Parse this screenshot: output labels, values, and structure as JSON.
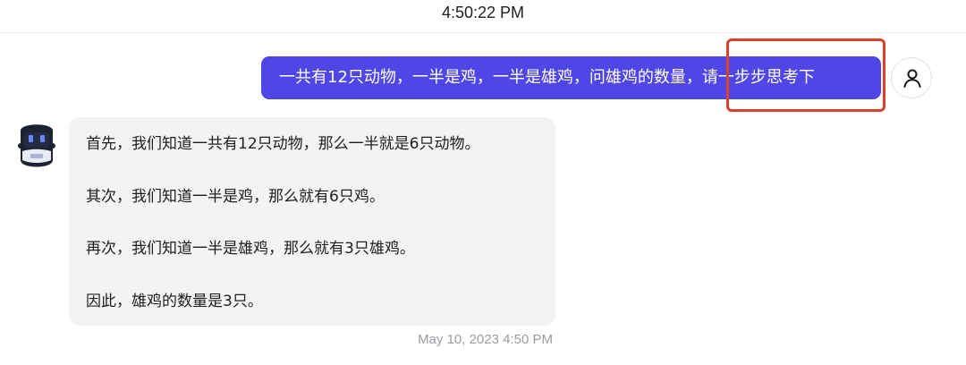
{
  "header": {
    "time": "4:50:22 PM"
  },
  "user_message": {
    "text": "一共有12只动物，一半是鸡，一半是雄鸡，问雄鸡的数量，请一步步思考下"
  },
  "bot_message": {
    "paragraphs": [
      "首先，我们知道一共有12只动物，那么一半就是6只动物。",
      "其次，我们知道一半是鸡，那么就有6只鸡。",
      "再次，我们知道一半是雄鸡，那么就有3只雄鸡。",
      "因此，雄鸡的数量是3只。"
    ],
    "timestamp": "May 10, 2023 4:50 PM"
  },
  "icons": {
    "user_avatar": "user-icon",
    "bot_avatar": "robot-icon"
  },
  "colors": {
    "user_bubble": "#5046e5",
    "bot_bubble": "#f3f3f5",
    "highlight": "#d8412c",
    "timestamp": "#9b9ba3"
  }
}
